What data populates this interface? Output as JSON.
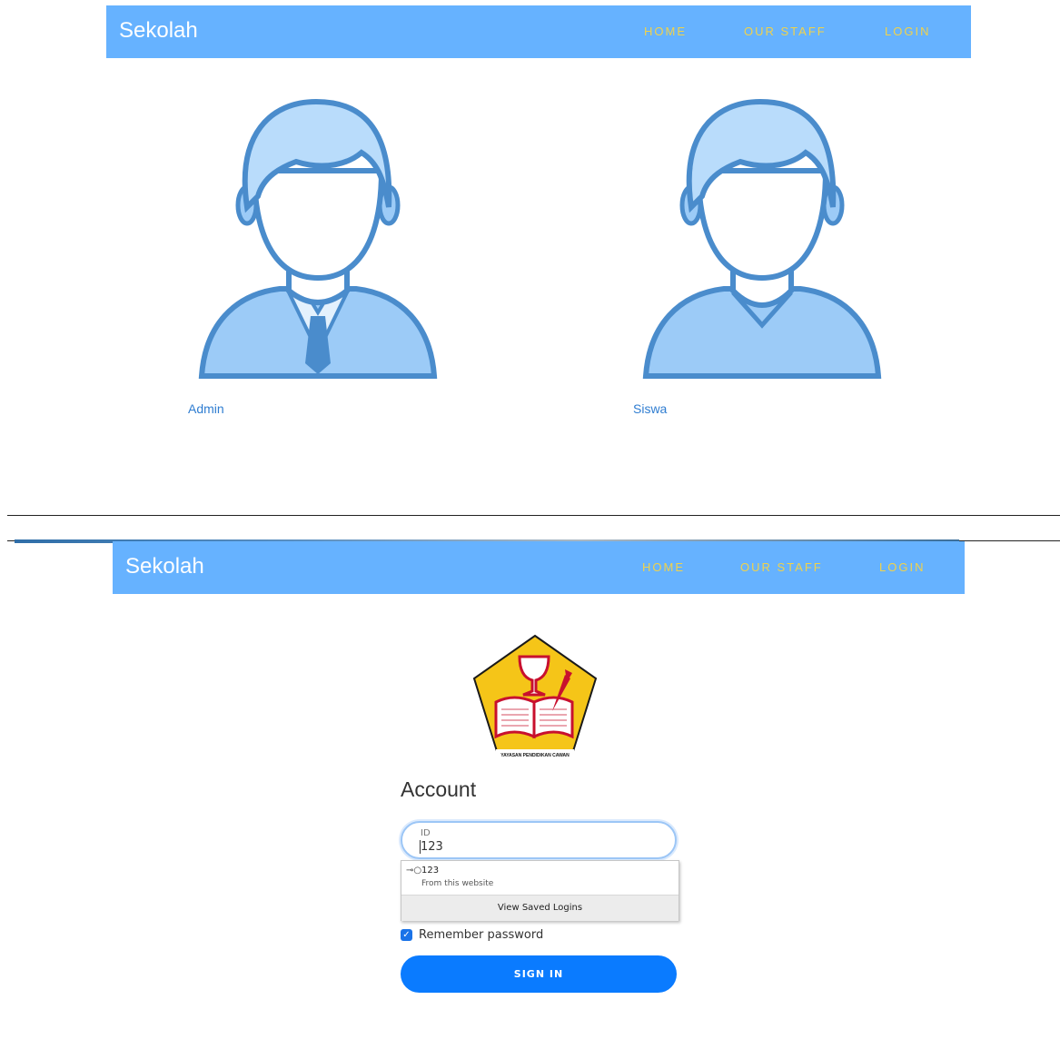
{
  "top_screen": {
    "navbar": {
      "brand": "Sekolah",
      "links": [
        "HOME",
        "OUR STAFF",
        "LOGIN"
      ]
    },
    "roles": [
      {
        "label": "Admin",
        "icon": "admin-avatar-icon"
      },
      {
        "label": "Siswa",
        "icon": "student-avatar-icon"
      }
    ]
  },
  "bottom_screen": {
    "navbar": {
      "brand": "Sekolah",
      "links": [
        "HOME",
        "OUR STAFF",
        "LOGIN"
      ]
    },
    "logo": {
      "icon": "school-emblem-icon",
      "caption": "YAYASAN PENDIDIKAN CAWAN"
    },
    "form": {
      "title": "Account",
      "id_field": {
        "label": "ID",
        "value": "123"
      },
      "autofill": {
        "username": "123",
        "source": "From this website",
        "view_saved": "View Saved Logins"
      },
      "remember": {
        "label": "Remember password",
        "checked": true
      },
      "submit": "SIGN IN"
    }
  },
  "colors": {
    "navbar": "#66b2ff",
    "nav_link": "#f1d24a",
    "primary_button": "#0a7bff",
    "avatar_fill": "#9ccbf7",
    "avatar_stroke": "#4a8ccc"
  }
}
